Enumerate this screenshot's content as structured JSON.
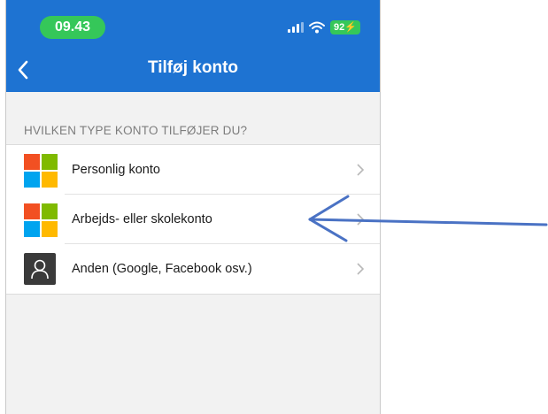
{
  "status_bar": {
    "time": "09.43",
    "battery": "92",
    "icons": [
      "signal-icon",
      "wifi-icon",
      "battery-icon"
    ]
  },
  "header": {
    "title": "Tilføj konto",
    "back_icon": "chevron-left-icon"
  },
  "section": {
    "header": "HVILKEN TYPE KONTO TILFØJER DU?"
  },
  "accounts": [
    {
      "label": "Personlig konto",
      "icon": "microsoft-logo-icon"
    },
    {
      "label": "Arbejds- eller skolekonto",
      "icon": "microsoft-logo-icon"
    },
    {
      "label": "Anden (Google, Facebook osv.)",
      "icon": "person-icon"
    }
  ],
  "colors": {
    "header": "#1e73d2",
    "status_green": "#35c759",
    "background": "#f2f2f2",
    "annotation_arrow": "#4a72c4"
  }
}
